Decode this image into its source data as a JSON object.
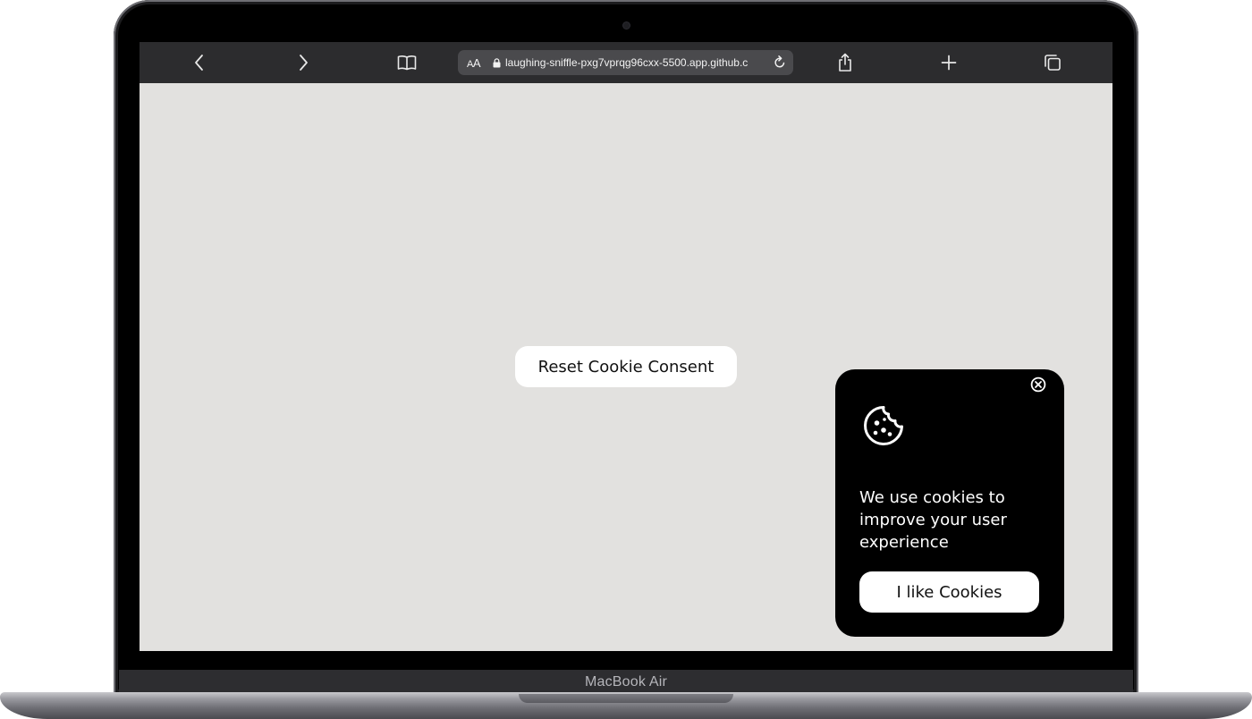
{
  "browser": {
    "url_text": "laughing-sniffle-pxg7vprqg96cxx-5500.app.github.c",
    "reader_label_small": "A",
    "reader_label_big": "A"
  },
  "page": {
    "reset_button_label": "Reset Cookie Consent"
  },
  "cookie_banner": {
    "message": "We use cookies to improve your user experience",
    "accept_label": "I like Cookies"
  },
  "device": {
    "label": "MacBook Air"
  },
  "colors": {
    "page_background": "#e2e1df",
    "toolbar_background": "#2c2c2e",
    "banner_background": "#000000",
    "button_background": "#ffffff"
  }
}
